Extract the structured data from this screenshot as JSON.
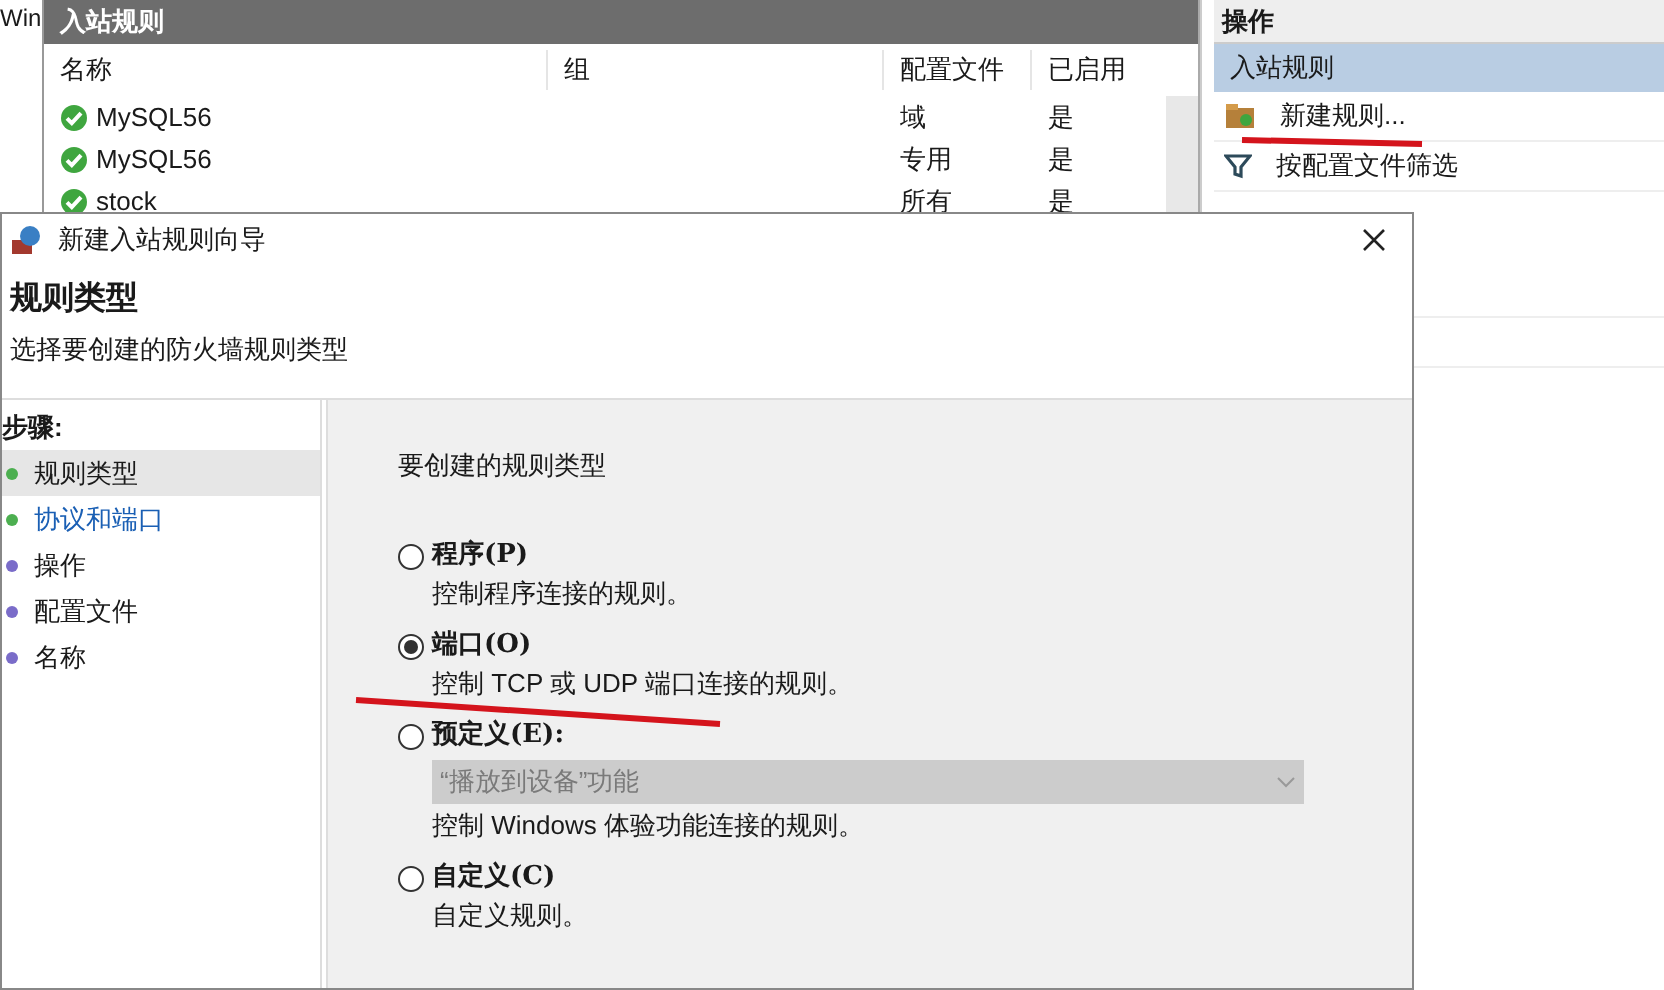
{
  "background_window": {
    "left_edge_text": "Win",
    "rules_panel": {
      "title": "入站规则",
      "columns": [
        "名称",
        "组",
        "配置文件",
        "已启用"
      ],
      "rows": [
        {
          "name": "MySQL56",
          "profile": "域",
          "enabled": "是"
        },
        {
          "name": "MySQL56",
          "profile": "专用",
          "enabled": "是"
        },
        {
          "name": "stock",
          "profile": "所有",
          "enabled": "是"
        }
      ]
    },
    "actions_panel": {
      "title": "操作",
      "section": "入站规则",
      "items": [
        {
          "label": "新建规则...",
          "kind": "new-rule"
        },
        {
          "label": "按配置文件筛选",
          "kind": "filter"
        }
      ]
    }
  },
  "dialog": {
    "title": "新建入站规则向导",
    "heading": "规则类型",
    "subtitle": "选择要创建的防火墙规则类型",
    "steps_label": "步骤:",
    "steps": [
      {
        "label": "规则类型",
        "selected": true,
        "hovered": false,
        "color": "#4caf50"
      },
      {
        "label": "协议和端口",
        "selected": false,
        "hovered": true,
        "color": "#4caf50"
      },
      {
        "label": "操作",
        "selected": false,
        "hovered": false,
        "color": "#7a6cc9"
      },
      {
        "label": "配置文件",
        "selected": false,
        "hovered": false,
        "color": "#7a6cc9"
      },
      {
        "label": "名称",
        "selected": false,
        "hovered": false,
        "color": "#7a6cc9"
      }
    ],
    "prompt": "要创建的规则类型",
    "options": [
      {
        "label": "程序(P)",
        "description": "控制程序连接的规则。",
        "selected": false
      },
      {
        "label": "端口(O)",
        "description": "控制 TCP 或 UDP 端口连接的规则。",
        "selected": true
      },
      {
        "label": "预定义(E):",
        "description": "控制 Windows 体验功能连接的规则。",
        "selected": false,
        "dropdown": {
          "value": "“播放到设备”功能",
          "disabled": true
        }
      },
      {
        "label": "自定义(C)",
        "description": "自定义规则。",
        "selected": false
      }
    ]
  }
}
